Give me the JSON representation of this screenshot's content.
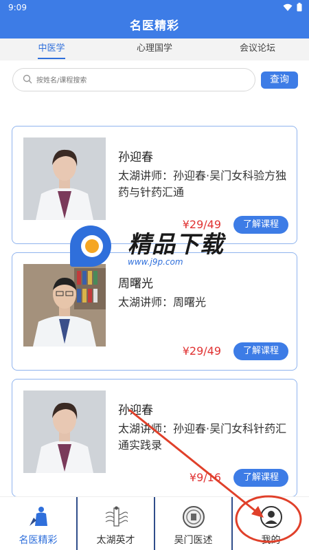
{
  "status": {
    "time": "9:09"
  },
  "app": {
    "title": "名医精彩"
  },
  "tabs": [
    {
      "label": "中医学",
      "active": true
    },
    {
      "label": "心理国学",
      "active": false
    },
    {
      "label": "会议论坛",
      "active": false
    }
  ],
  "search": {
    "placeholder": "按姓名/课程搜索",
    "button": "查询"
  },
  "courses": [
    {
      "name": "孙迎春",
      "desc": "太湖讲师：孙迎春·吴门女科验方独药与针药汇通",
      "price": "¥29/49",
      "action": "了解课程"
    },
    {
      "name": "周曙光",
      "desc": "太湖讲师：周曙光",
      "price": "¥29/49",
      "action": "了解课程"
    },
    {
      "name": "孙迎春",
      "desc": "太湖讲师：孙迎春·吴门女科针药汇通实践录",
      "price": "¥9/16",
      "action": "了解课程"
    }
  ],
  "watermark": {
    "text": "精品下载",
    "url": "www.j9p.com"
  },
  "bottom_nav": [
    {
      "label": "名医精彩",
      "icon": "doctor-icon",
      "active": true
    },
    {
      "label": "太湖英才",
      "icon": "talent-icon",
      "active": false
    },
    {
      "label": "吴门医述",
      "icon": "seal-icon",
      "active": false
    },
    {
      "label": "我的",
      "icon": "profile-icon",
      "active": false
    }
  ],
  "colors": {
    "primary": "#3d7ce6",
    "price": "#e03232",
    "annotation": "#e0402a"
  }
}
